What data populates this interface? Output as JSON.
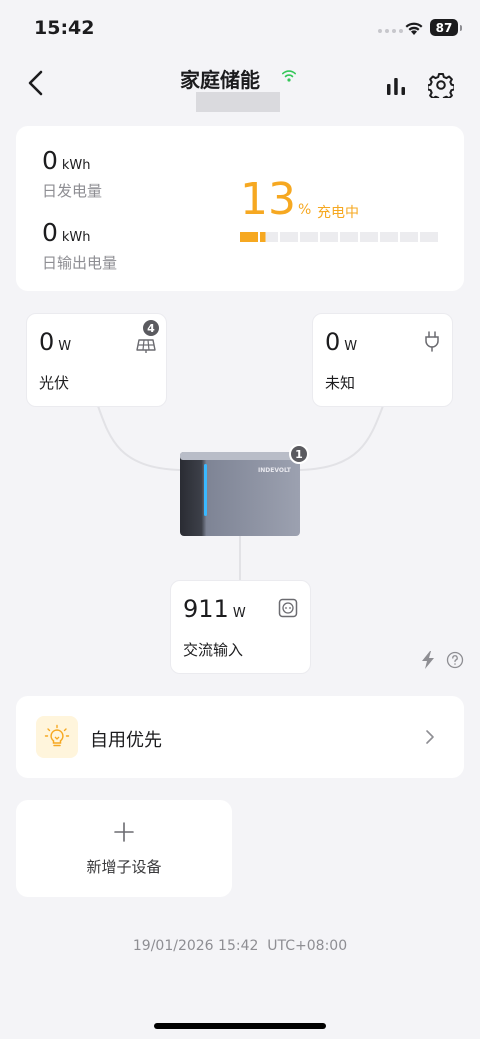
{
  "status_bar": {
    "time": "15:42",
    "battery": "87"
  },
  "header": {
    "title": "家庭储能"
  },
  "summary": {
    "daily_generation": {
      "value": "0",
      "unit": "kWh",
      "label": "日发电量"
    },
    "daily_output": {
      "value": "0",
      "unit": "kWh",
      "label": "日输出电量"
    },
    "soc": {
      "value": "13",
      "unit": "%",
      "status": "充电中",
      "level_percent": 13,
      "segments": 10
    }
  },
  "nodes": {
    "pv": {
      "value": "0",
      "unit": "W",
      "label": "光伏",
      "badge": "4",
      "icon": "solar-panel-icon"
    },
    "unknown": {
      "value": "0",
      "unit": "W",
      "label": "未知",
      "icon": "plug-icon"
    },
    "device": {
      "badge": "1",
      "brand": "INDEVOLT"
    },
    "ac_input": {
      "value": "911",
      "unit": "W",
      "label": "交流输入",
      "icon": "outlet-icon"
    }
  },
  "mode": {
    "label": "自用优先",
    "icon": "lightbulb-icon"
  },
  "add_device": {
    "label": "新增子设备"
  },
  "footer": {
    "timestamp": "19/01/2026 15:42  UTC+08:00"
  },
  "colors": {
    "accent": "#f6a821",
    "wifi": "#34c759",
    "background": "#f4f4f7"
  }
}
